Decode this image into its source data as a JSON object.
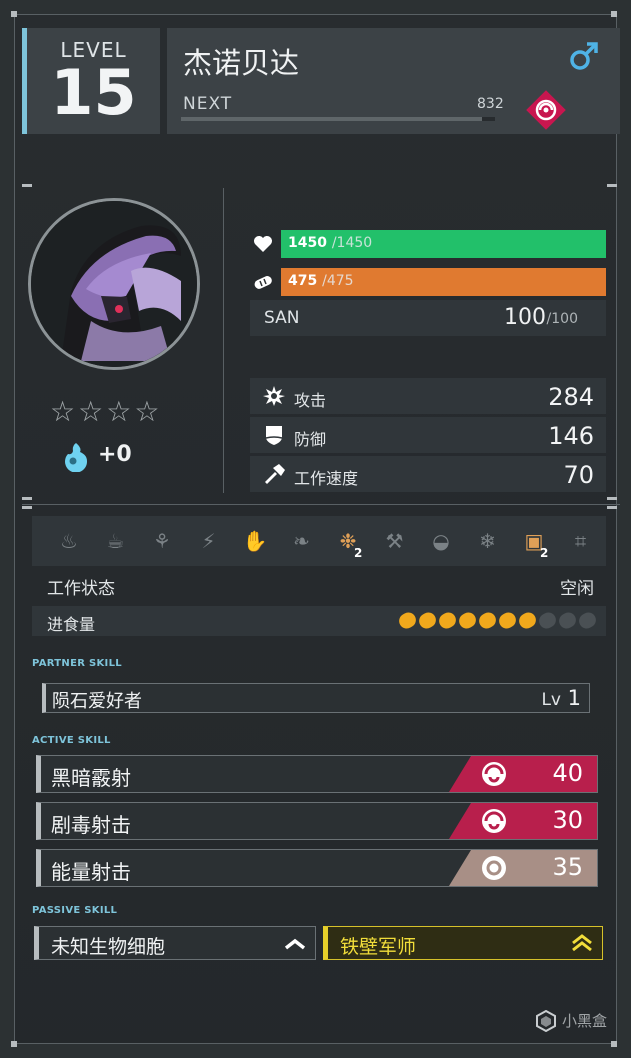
{
  "level": {
    "label": "LEVEL",
    "value": "15"
  },
  "pal": {
    "name": "杰诺贝达",
    "gender_icon": "male-symbol-icon",
    "element_icon": "dark-element-icon",
    "next_label": "NEXT",
    "next_value": "832",
    "exp_fill_percent": 0.96
  },
  "portrait": {
    "label": "pal-portrait"
  },
  "rank": {
    "stars_filled": 0,
    "stars_total": 4,
    "soul_value": "+0"
  },
  "hp": {
    "current": "1450",
    "max": "/1450",
    "fill": 1.0,
    "color": "#22c06a"
  },
  "food": {
    "current": "475",
    "max": "/475",
    "fill": 1.0,
    "color": "#e07a30"
  },
  "san": {
    "label": "SAN",
    "current": "100",
    "max": "/100"
  },
  "stats": [
    {
      "label": "攻击",
      "value": "284",
      "icon": "attack-burst-icon"
    },
    {
      "label": "防御",
      "value": "146",
      "icon": "shield-icon"
    },
    {
      "label": "工作速度",
      "value": "70",
      "icon": "hammer-icon"
    }
  ],
  "work_suitability": [
    {
      "icon": "kindling-icon",
      "active": false,
      "level": ""
    },
    {
      "icon": "watering-icon",
      "active": false,
      "level": ""
    },
    {
      "icon": "planting-icon",
      "active": false,
      "level": ""
    },
    {
      "icon": "electricity-icon",
      "active": false,
      "level": ""
    },
    {
      "icon": "handiwork-icon",
      "active": false,
      "level": ""
    },
    {
      "icon": "gathering-icon",
      "active": false,
      "level": ""
    },
    {
      "icon": "lumbering-icon",
      "active": true,
      "level": "2"
    },
    {
      "icon": "mining-icon",
      "active": false,
      "level": ""
    },
    {
      "icon": "medicine-icon",
      "active": false,
      "level": ""
    },
    {
      "icon": "cooling-icon",
      "active": false,
      "level": ""
    },
    {
      "icon": "transporting-icon",
      "active": true,
      "level": "2"
    },
    {
      "icon": "farming-icon",
      "active": false,
      "level": ""
    }
  ],
  "work_status": {
    "label": "工作状态",
    "value": "空闲"
  },
  "food_intake": {
    "label": "进食量",
    "filled": 7,
    "total": 10
  },
  "partner_skill": {
    "title": "PARTNER SKILL",
    "name": "陨石爱好者",
    "lv_label": "Lv",
    "lv_value": "1"
  },
  "active_skill": {
    "title": "ACTIVE SKILL",
    "skills": [
      {
        "name": "黑暗霰射",
        "power": "40",
        "element": "dark",
        "color": "#b81f4c",
        "icon": "dark-swirl-icon"
      },
      {
        "name": "剧毒射击",
        "power": "30",
        "element": "dark",
        "color": "#b81f4c",
        "icon": "dark-swirl-icon"
      },
      {
        "name": "能量射击",
        "power": "35",
        "element": "neutral",
        "color": "#a88f86",
        "icon": "neutral-ring-icon"
      }
    ]
  },
  "passive_skill": {
    "title": "PASSIVE SKILL",
    "skills": [
      {
        "name": "未知生物细胞",
        "rank": "rank-up-1-icon",
        "highlight": false
      },
      {
        "name": "铁壁军师",
        "rank": "rank-up-2-icon",
        "highlight": true
      }
    ]
  },
  "watermark": {
    "text": "小黑盒"
  }
}
